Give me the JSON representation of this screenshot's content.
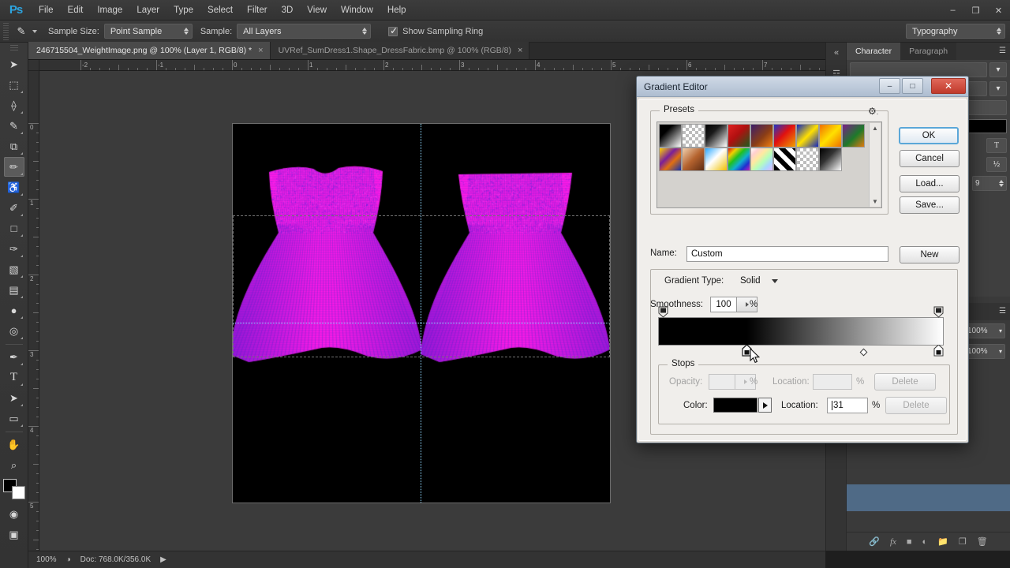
{
  "app": {
    "name": "Ps",
    "logo": "Ps"
  },
  "menubar": {
    "items": [
      "File",
      "Edit",
      "Image",
      "Layer",
      "Type",
      "Select",
      "Filter",
      "3D",
      "View",
      "Window",
      "Help"
    ],
    "window_controls": [
      "minimize",
      "restore",
      "close"
    ]
  },
  "options_bar": {
    "tool_icon": "eyedropper-icon",
    "sample_size_label": "Sample Size:",
    "sample_size_value": "Point Sample",
    "sample_label": "Sample:",
    "sample_value": "All Layers",
    "show_sampling_ring_label": "Show Sampling Ring",
    "show_sampling_ring_checked": true,
    "workspace": "Typography"
  },
  "document_tabs": [
    {
      "label": "246715504_WeightImage.png @ 100% (Layer 1, RGB/8) *",
      "active": true,
      "close": "×"
    },
    {
      "label": "UVRef_SumDress1.Shape_DressFabric.bmp @ 100% (RGB/8)",
      "active": false,
      "close": "×"
    }
  ],
  "rulers": {
    "horizontal_ticks": [
      "-2",
      "-1",
      "0",
      "1",
      "2",
      "3",
      "4",
      "5",
      "6",
      "7"
    ],
    "vertical_ticks": [
      "0",
      "1",
      "2",
      "3",
      "4",
      "5"
    ],
    "unit": "inches"
  },
  "canvas": {
    "background": "#3b3b3b",
    "artboard_color": "#000000",
    "object_color": "#ff19e6",
    "shade_color": "#5a2bd0",
    "description": "Two magenta dress UV maps on a black canvas with dotted guides and a dashed rectangular marquee selection"
  },
  "toolbar": {
    "tools": [
      {
        "name": "move-tool",
        "glyph": "➤",
        "selected": false
      },
      {
        "name": "marquee-tool",
        "glyph": "⬚",
        "selected": false
      },
      {
        "name": "lasso-tool",
        "glyph": "❀",
        "selected": false
      },
      {
        "name": "quick-selection-tool",
        "glyph": "✎",
        "selected": false
      },
      {
        "name": "crop-tool",
        "glyph": "⧉",
        "selected": false
      },
      {
        "name": "eyedropper-tool",
        "glyph": "✒",
        "selected": true
      },
      {
        "name": "healing-brush-tool",
        "glyph": "⚕",
        "selected": false
      },
      {
        "name": "brush-tool",
        "glyph": "✐",
        "selected": false
      },
      {
        "name": "clone-stamp-tool",
        "glyph": "⚑",
        "selected": false
      },
      {
        "name": "history-brush-tool",
        "glyph": "✑",
        "selected": false
      },
      {
        "name": "eraser-tool",
        "glyph": "◧",
        "selected": false
      },
      {
        "name": "gradient-tool",
        "glyph": "▤",
        "selected": false
      },
      {
        "name": "blur-tool",
        "glyph": "●",
        "selected": false
      },
      {
        "name": "dodge-tool",
        "glyph": "◎",
        "selected": false
      },
      {
        "name": "pen-tool",
        "glyph": "✒",
        "selected": false
      },
      {
        "name": "type-tool",
        "glyph": "T",
        "selected": false
      },
      {
        "name": "path-selection-tool",
        "glyph": "➤",
        "selected": false
      },
      {
        "name": "rectangle-tool",
        "glyph": "▭",
        "selected": false
      },
      {
        "name": "hand-tool",
        "glyph": "✋",
        "selected": false
      },
      {
        "name": "zoom-tool",
        "glyph": "⌕",
        "selected": false
      }
    ],
    "foreground_color": "#000000",
    "background_color": "#ffffff",
    "quick_mask": "quick-mask-icon",
    "screen_mode": "screen-mode-icon"
  },
  "right_dock": {
    "panel_tabs": [
      {
        "label": "Character",
        "active": true
      },
      {
        "label": "Paragraph",
        "active": false
      }
    ],
    "panel_menu": "panel-menu-icon",
    "character": {
      "size_value": "",
      "tracking_value": "9",
      "faux_bold": "T",
      "fraction": "½"
    },
    "layers_bottom_icons": [
      "link-icon",
      "fx-icon",
      "mask-icon",
      "adjustment-icon",
      "folder-icon",
      "new-layer-icon",
      "trash-icon"
    ],
    "opacity_value": "100%",
    "fill_value": "100%"
  },
  "status_bar": {
    "zoom": "100%",
    "doc_info": "Doc: 768.0K/356.0K",
    "arrow": "▶"
  },
  "dialog": {
    "title": "Gradient Editor",
    "window_controls": {
      "minimize": "–",
      "restore": "□",
      "close": "✕"
    },
    "presets": {
      "legend": "Presets",
      "gear_icon": "gear-icon",
      "scroll_up": "▲",
      "scroll_down": "▼",
      "swatches": [
        "black-white",
        "white-transparent-checker",
        "black-to-white-soft",
        "red-green",
        "violet-orange",
        "blue-red-yellow",
        "blue-yellow-blue",
        "orange-yellow-orange",
        "violet-green-orange",
        "yellow-violet-orange-blue",
        "copper",
        "blue-yellow",
        "spectrum",
        "pastel-rainbow",
        "stripes-black-white",
        "transparent-checker",
        "black-white-soft"
      ]
    },
    "buttons": {
      "ok": "OK",
      "cancel": "Cancel",
      "load": "Load...",
      "save": "Save...",
      "new": "New"
    },
    "name_label": "Name:",
    "name_value": "Custom",
    "gradient_type_label": "Gradient Type:",
    "gradient_type_value": "Solid",
    "smoothness_label": "Smoothness:",
    "smoothness_value": "100",
    "smoothness_unit": "%",
    "gradient_ramp": {
      "left_color": "#000000",
      "right_color": "#ffffff",
      "selected_stop_location_pct": 31,
      "midpoint_pct": 72,
      "opacity_stops_pct": [
        0,
        100
      ]
    },
    "stops": {
      "legend": "Stops",
      "opacity_label": "Opacity:",
      "opacity_value": "",
      "opacity_unit": "%",
      "opacity_location_label": "Location:",
      "opacity_location_value": "",
      "opacity_location_unit": "%",
      "opacity_delete": "Delete",
      "color_label": "Color:",
      "color_value": "#000000",
      "color_location_label": "Location:",
      "color_location_value": "31",
      "color_location_unit": "%",
      "color_delete": "Delete"
    }
  }
}
